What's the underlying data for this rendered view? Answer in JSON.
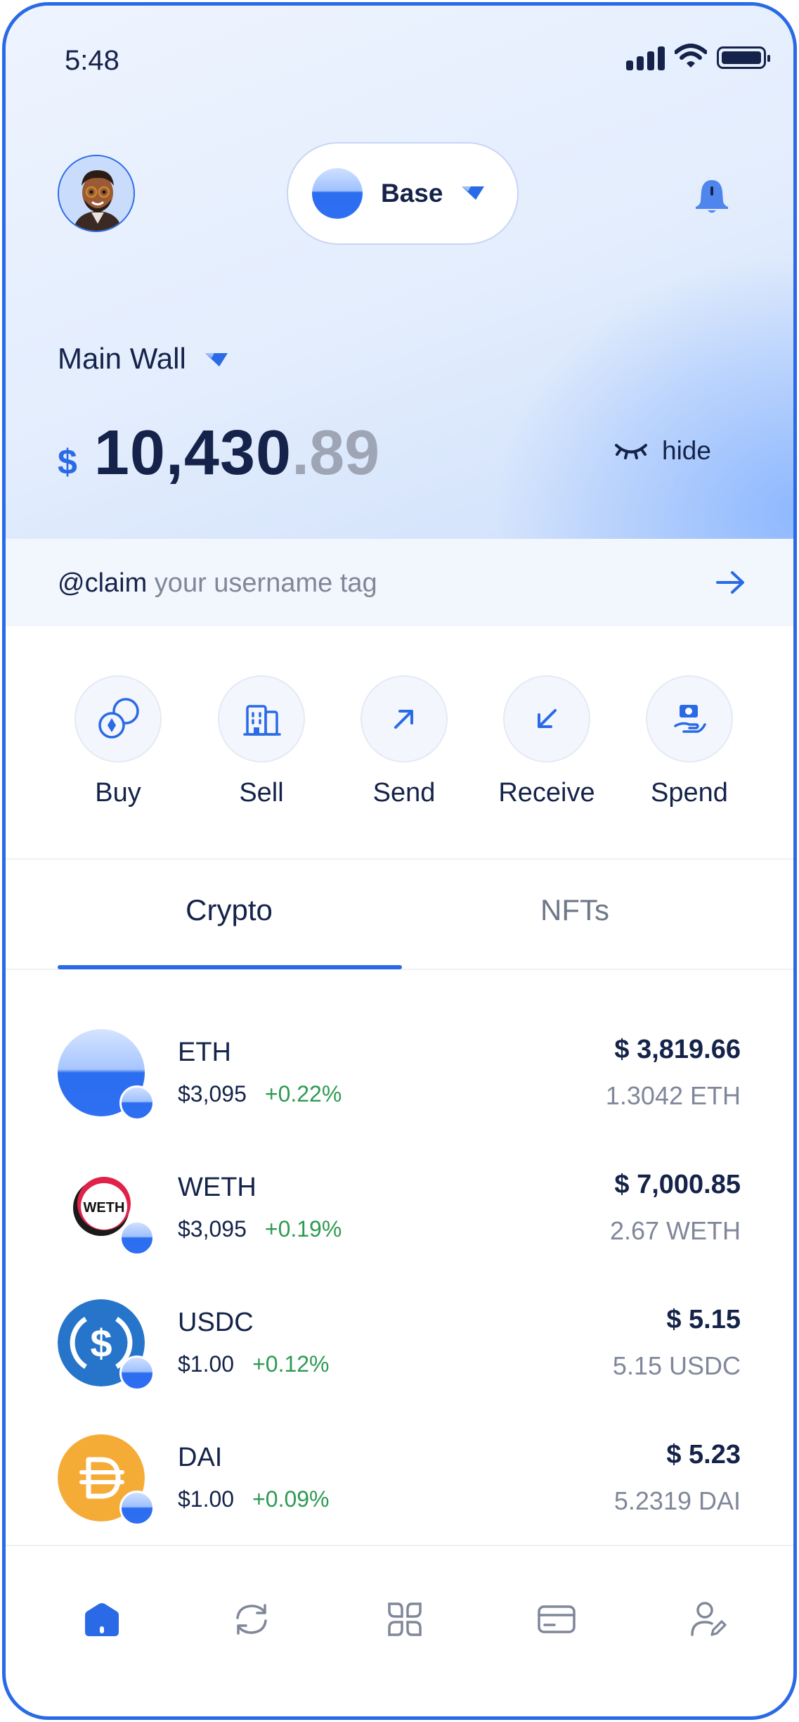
{
  "status_bar": {
    "time": "5:48"
  },
  "header": {
    "network_label": "Base",
    "wallet_name": "Main Wall"
  },
  "balance": {
    "currency": "$",
    "integer_part": "10,430",
    "decimal_part": ".89",
    "hide_label": "hide"
  },
  "claim": {
    "bold": "@claim",
    "rest": " your username tag"
  },
  "actions": [
    {
      "label": "Buy",
      "icon": "buy-icon"
    },
    {
      "label": "Sell",
      "icon": "sell-icon"
    },
    {
      "label": "Send",
      "icon": "send-arrow-icon"
    },
    {
      "label": "Receive",
      "icon": "receive-arrow-icon"
    },
    {
      "label": "Spend",
      "icon": "spend-icon"
    }
  ],
  "tabs": [
    {
      "label": "Crypto",
      "active": true
    },
    {
      "label": "NFTs",
      "active": false
    }
  ],
  "assets": [
    {
      "symbol": "ETH",
      "price": "$3,095",
      "change": "+0.22%",
      "value": "$ 3,819.66",
      "quantity": "1.3042 ETH",
      "icon": "eth-icon"
    },
    {
      "symbol": "WETH",
      "price": "$3,095",
      "change": "+0.19%",
      "value": "$ 7,000.85",
      "quantity": "2.67 WETH",
      "icon": "weth-icon",
      "icon_text": "WETH"
    },
    {
      "symbol": "USDC",
      "price": "$1.00",
      "change": "+0.12%",
      "value": "$ 5.15",
      "quantity": "5.15 USDC",
      "icon": "usdc-icon"
    },
    {
      "symbol": "DAI",
      "price": "$1.00",
      "change": "+0.09%",
      "value": "$ 5.23",
      "quantity": "5.2319 DAI",
      "icon": "dai-icon"
    }
  ],
  "bottom_nav": [
    {
      "icon": "home-icon",
      "active": true
    },
    {
      "icon": "swap-icon",
      "active": false
    },
    {
      "icon": "apps-icon",
      "active": false
    },
    {
      "icon": "card-icon",
      "active": false
    },
    {
      "icon": "profile-icon",
      "active": false
    }
  ],
  "colors": {
    "accent": "#2a6ae6",
    "text": "#15234a",
    "muted": "#7f8799",
    "positive": "#2f9a53"
  }
}
